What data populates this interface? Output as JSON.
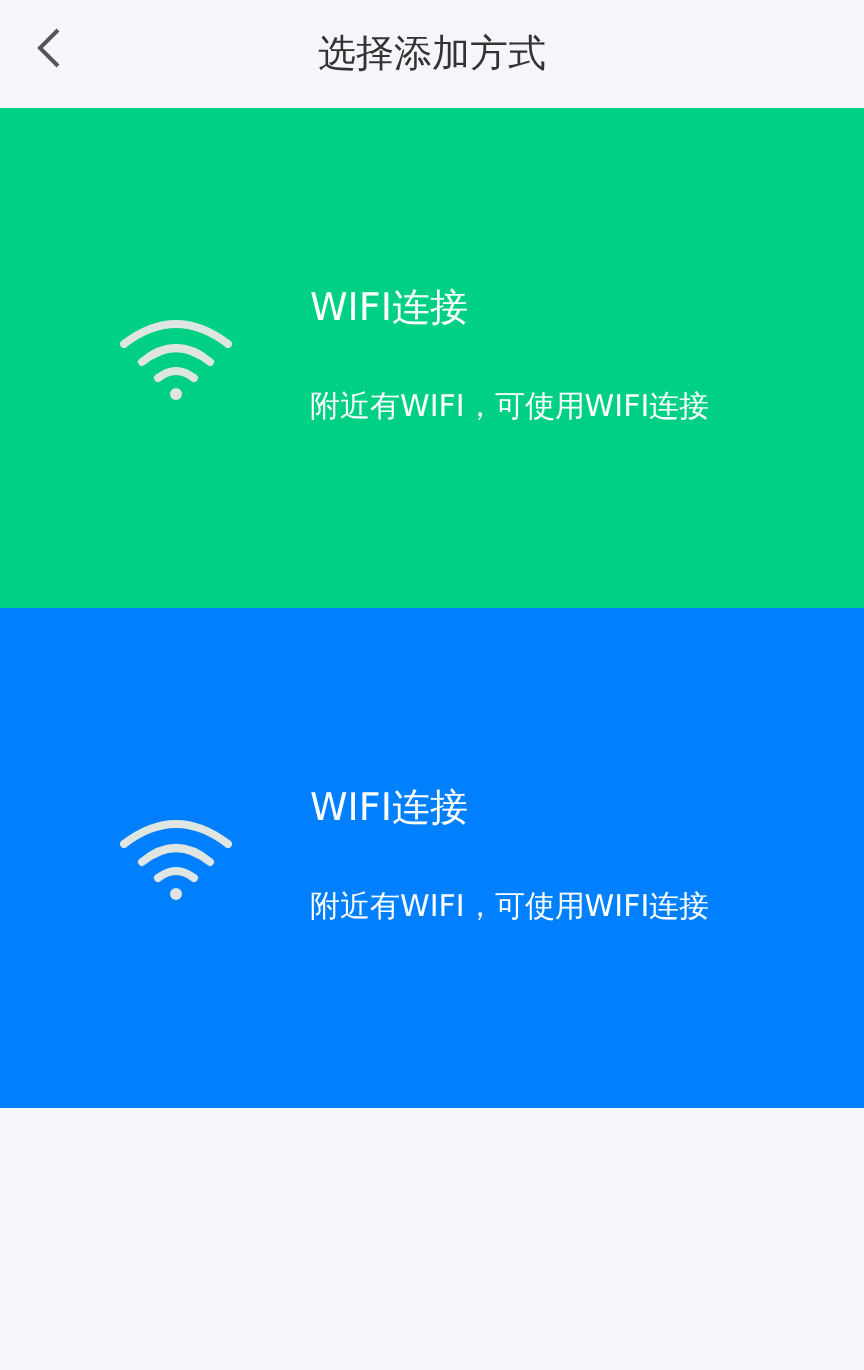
{
  "header": {
    "title": "选择添加方式"
  },
  "options": [
    {
      "title": "WIFI连接",
      "description": "附近有WIFI，可使用WIFI连接",
      "color": "#00d084"
    },
    {
      "title": "WIFI连接",
      "description": "附近有WIFI，可使用WIFI连接",
      "color": "#0080ff"
    }
  ]
}
